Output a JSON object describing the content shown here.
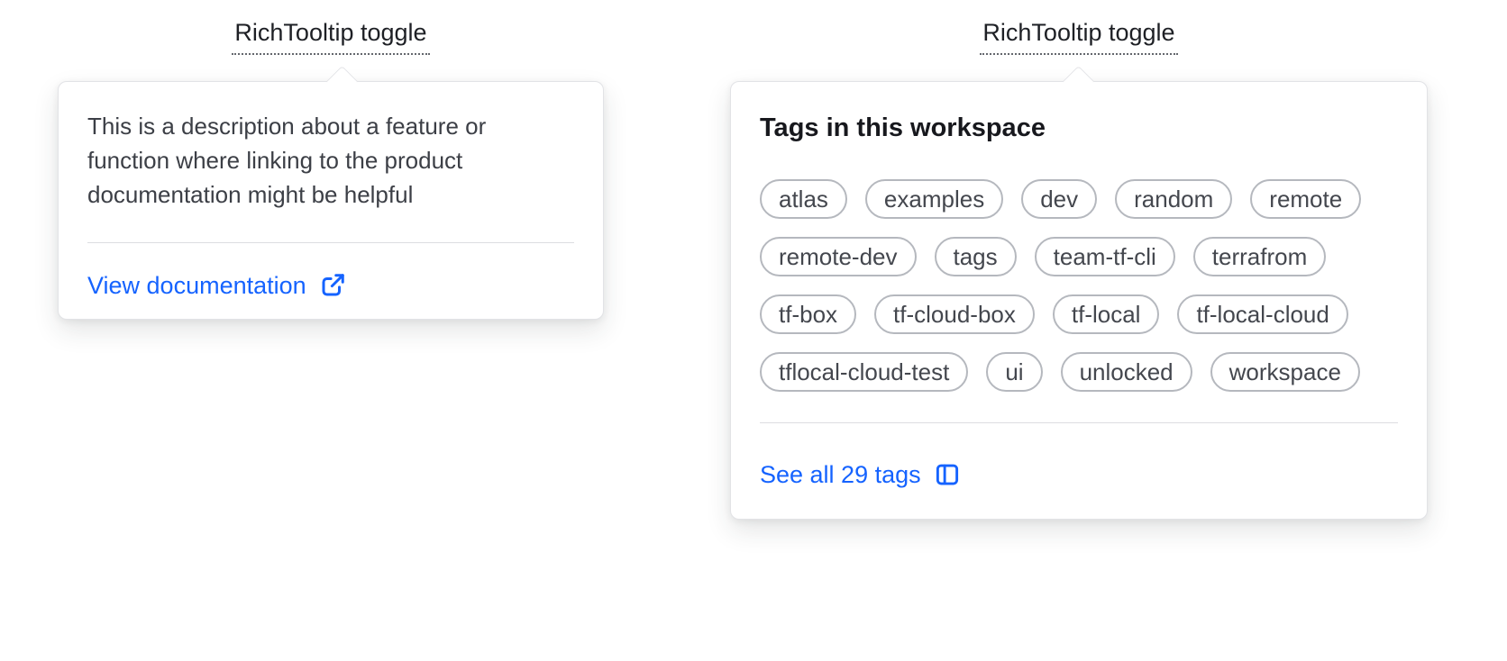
{
  "colors": {
    "link_blue": "#1563ff",
    "text_primary": "#3c3f46",
    "heading_text": "#17181d",
    "tag_border": "#b5b8be",
    "card_border": "#e2e3e6",
    "background": "#ffffff"
  },
  "left_tooltip": {
    "toggle_label": "RichTooltip toggle",
    "description": "This is a description about a feature or function where linking to the product documentation might be helpful",
    "link_label": "View documentation",
    "link_icon": "external-link-icon"
  },
  "right_tooltip": {
    "toggle_label": "RichTooltip toggle",
    "heading": "Tags in this workspace",
    "tags": [
      "atlas",
      "examples",
      "dev",
      "random",
      "remote",
      "remote-dev",
      "tags",
      "team-tf-cli",
      "terrafrom",
      "tf-box",
      "tf-cloud-box",
      "tf-local",
      "tf-local-cloud",
      "tflocal-cloud-test",
      "ui",
      "unlocked",
      "workspace"
    ],
    "link_label": "See all 29 tags",
    "link_icon": "sidebar-icon"
  }
}
